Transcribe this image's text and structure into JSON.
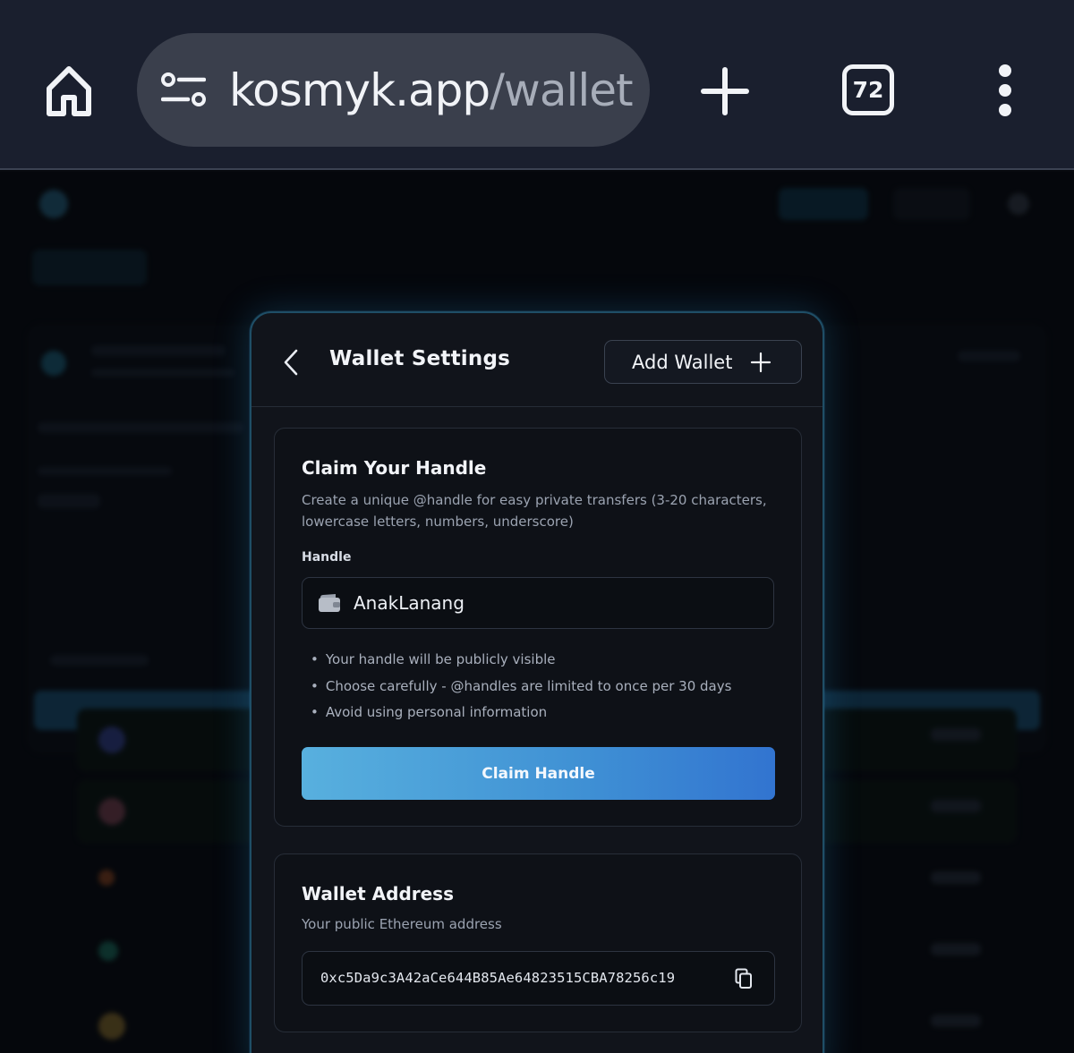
{
  "browser": {
    "url_domain": "kosmyk.app",
    "url_path": "/wallet",
    "tab_count": "72",
    "icons": [
      "home-icon",
      "site-settings-icon",
      "new-tab-icon",
      "tabs-icon",
      "more-menu-icon"
    ]
  },
  "modal": {
    "title": "Wallet Settings",
    "add_wallet_label": "Add Wallet",
    "handle_card": {
      "title": "Claim Your Handle",
      "description": "Create a unique @handle for easy private transfers (3-20 characters, lowercase letters, numbers, underscore)",
      "field_label": "Handle",
      "input_value": "AnakLanang",
      "tips": [
        "Your handle will be publicly visible",
        "Choose carefully - @handles are limited to once per 30 days",
        "Avoid using personal information"
      ],
      "button_label": "Claim Handle"
    },
    "address_card": {
      "title": "Wallet Address",
      "description": "Your public Ethereum address",
      "address": "0xc5Da9c3A42aCe644B85Ae64823515CBA78256c19"
    }
  },
  "colors": {
    "accent_blue": "#3f90d4",
    "modal_glow": "#1f4e66",
    "browser_bar": "#1a1f2e"
  }
}
